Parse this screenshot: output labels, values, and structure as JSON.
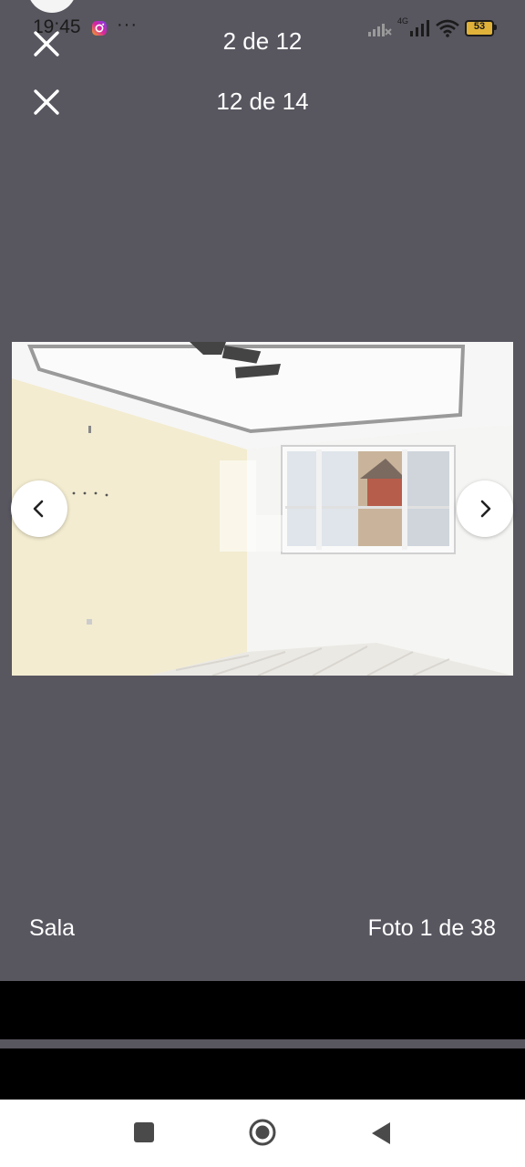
{
  "status_bar": {
    "time": "19:45",
    "more": "···",
    "network_label": "4G",
    "battery_level": "53"
  },
  "viewer": {
    "counter_top": "2 de 12",
    "counter_second": "12 de 14",
    "caption_room": "Sala",
    "caption_photo": "Foto 1 de 38"
  },
  "icons": {
    "close": "close-icon",
    "prev": "chevron-left-icon",
    "next": "chevron-right-icon",
    "recents": "recents-square-icon",
    "home": "home-circle-icon",
    "back": "back-triangle-icon"
  },
  "colors": {
    "background": "#58565f",
    "text": "#ffffff"
  }
}
